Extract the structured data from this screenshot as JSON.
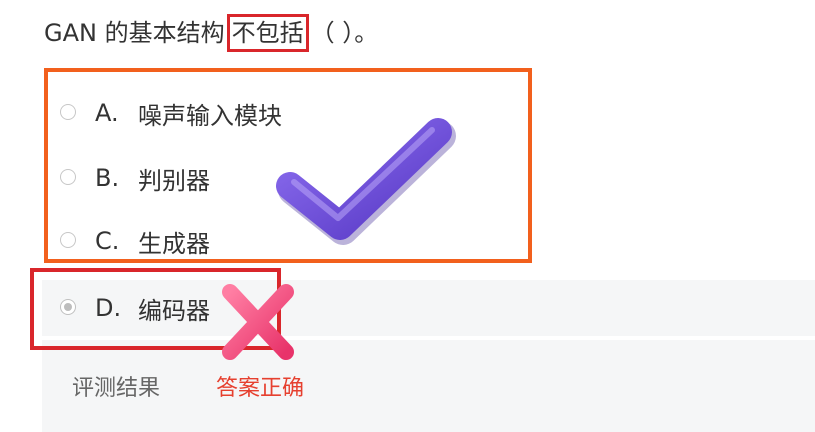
{
  "question": {
    "prefix": "GAN 的基本结构",
    "highlight": "不包括",
    "suffix": "（ ）。"
  },
  "options": [
    {
      "letter": "A.",
      "text": "噪声输入模块",
      "selected": false
    },
    {
      "letter": "B.",
      "text": "判别器",
      "selected": false
    },
    {
      "letter": "C.",
      "text": "生成器",
      "selected": false
    },
    {
      "letter": "D.",
      "text": "编码器",
      "selected": true
    }
  ],
  "result": {
    "label": "评测结果",
    "value": "答案正确"
  },
  "colors": {
    "orange_box": "#f2601d",
    "red_box": "#d9262b",
    "correct_text": "#e6402f",
    "check_purple": "#6a4bd6",
    "cross_pink": "#f0507a"
  },
  "icons": {
    "check": "check-icon",
    "cross": "cross-icon"
  }
}
